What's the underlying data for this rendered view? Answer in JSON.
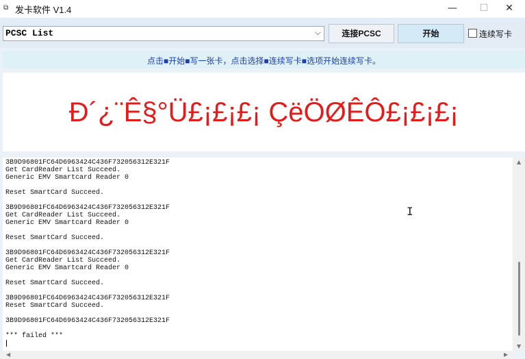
{
  "window": {
    "title": "发卡软件 V1.4",
    "app_icon": "app-icon",
    "minimize_glyph": "—",
    "maximize_glyph": "☐",
    "close_glyph": "✕"
  },
  "toolbar": {
    "reader_select_value": "PCSC List",
    "reader_select_arrow": "⌵",
    "connect_label": "连接PCSC",
    "start_label": "开始",
    "continuous_label": "连续写卡"
  },
  "hint": {
    "text": "点击■开始■写一张卡，点击选择■连续写卡■选项开始连续写卡。"
  },
  "status": {
    "text": "Ð´¿¨Ê§°Ü£¡£¡£¡ ÇëÖØÊÔ£¡£¡£¡",
    "color": "#e31b1b"
  },
  "log": {
    "lines": [
      "3B9D96801FC64D6963424C436F732056312E321F",
      "Get CardReader List Succeed.",
      "Generic EMV Smartcard Reader 0",
      "",
      "Reset SmartCard Succeed.",
      "",
      "3B9D96801FC64D6963424C436F732056312E321F",
      "Get CardReader List Succeed.",
      "Generic EMV Smartcard Reader 0",
      "",
      "Reset SmartCard Succeed.",
      "",
      "3B9D96801FC64D6963424C436F732056312E321F",
      "Get CardReader List Succeed.",
      "Generic EMV Smartcard Reader 0",
      "",
      "Reset SmartCard Succeed.",
      "",
      "3B9D96801FC64D6963424C436F732056312E321F",
      "Reset SmartCard Succeed.",
      "",
      "3B9D96801FC64D6963424C436F732056312E321F",
      "",
      "*** failed ***"
    ]
  },
  "scrollbars": {
    "up": "▲",
    "down": "▼",
    "left": "◀",
    "right": "▶"
  }
}
